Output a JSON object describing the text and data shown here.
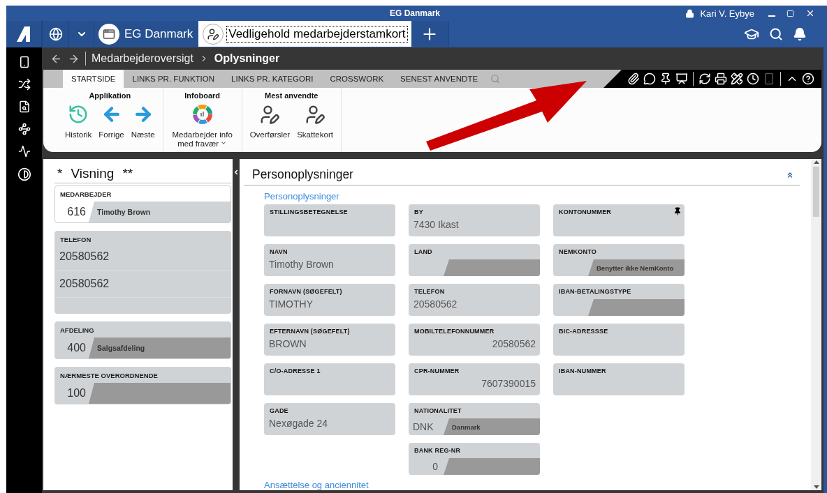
{
  "window": {
    "title": "EG Danmark",
    "user": "Kari V. Eybye"
  },
  "app_tabs": [
    {
      "label": "EG Danmark",
      "selected": false
    },
    {
      "label": "Vedligehold medarbejderstamkort",
      "selected": true
    }
  ],
  "breadcrumb": {
    "parent": "Medarbejderoversigt",
    "current": "Oplysninger"
  },
  "ribbon_tabs": [
    {
      "label": "STARTSIDE",
      "selected": true
    },
    {
      "label": "LINKS PR. FUNKTION",
      "selected": false
    },
    {
      "label": "LINKS PR. KATEGORI",
      "selected": false
    },
    {
      "label": "CROSSWORK",
      "selected": false
    },
    {
      "label": "SENEST ANVENDTE",
      "selected": false
    }
  ],
  "toolbar": [
    {
      "kind": "attach",
      "disabled": false
    },
    {
      "kind": "chat",
      "disabled": false
    },
    {
      "kind": "pin",
      "disabled": false
    },
    {
      "kind": "presentation",
      "disabled": false
    },
    {
      "kind": "separator"
    },
    {
      "kind": "refresh",
      "disabled": false
    },
    {
      "kind": "print",
      "disabled": false
    },
    {
      "kind": "tools",
      "disabled": false
    },
    {
      "kind": "clock",
      "disabled": false
    },
    {
      "kind": "device",
      "disabled": true
    },
    {
      "kind": "separator"
    },
    {
      "kind": "collapse",
      "disabled": false
    },
    {
      "kind": "help",
      "disabled": false
    }
  ],
  "ribbon_groups": [
    {
      "title": "Applikation",
      "items": [
        {
          "label": "Historik",
          "kind": "history",
          "dropdown": false
        },
        {
          "label": "Forrige",
          "kind": "back",
          "dropdown": false
        },
        {
          "label": "Næste",
          "kind": "forward",
          "dropdown": false
        }
      ]
    },
    {
      "title": "Infoboard",
      "items": [
        {
          "label": "Medarbejder info med fravær",
          "kind": "chart",
          "dropdown": true
        }
      ]
    },
    {
      "title": "Mest anvendte",
      "items": [
        {
          "label": "Overførsler",
          "kind": "user-edit",
          "dropdown": false
        },
        {
          "label": "Skattekort",
          "kind": "user-edit",
          "dropdown": false
        }
      ]
    }
  ],
  "left_panel": {
    "prefix": "*",
    "title": "Visning",
    "suffix": "**",
    "cards": [
      {
        "label": "MEDARBEJDER",
        "kind": "lookup",
        "selected": true,
        "code": "616",
        "description": "Timothy Brown"
      },
      {
        "label": "TELEFON",
        "kind": "list",
        "selected": false,
        "lines": [
          "20580562",
          "20580562"
        ]
      },
      {
        "label": "AFDELING",
        "kind": "lookup",
        "selected": false,
        "code": "400",
        "description": "Salgsafdeling"
      },
      {
        "label": "NÆRMESTE OVERORDNENDE",
        "kind": "lookup",
        "selected": false,
        "code": "100"
      }
    ]
  },
  "section": {
    "title": "Personoplysninger",
    "group_title": "Personoplysninger",
    "next_group": "Ansættelse og anciennitet",
    "columns": [
      [
        {
          "label": "STILLINGSBETEGNELSE",
          "kind": "text",
          "pinned": false
        },
        {
          "label": "NAVN",
          "kind": "text",
          "value": "Timothy Brown",
          "pinned": false
        },
        {
          "label": "FORNAVN (SØGEFELT)",
          "kind": "text",
          "value": "TIMOTHY",
          "pinned": false
        },
        {
          "label": "EFTERNAVN (SØGEFELT)",
          "kind": "text",
          "value": "BROWN",
          "pinned": false
        },
        {
          "label": "C/O-ADRESSE 1",
          "kind": "text",
          "pinned": false
        },
        {
          "label": "GADE",
          "kind": "text",
          "value": "Nexøgade 24",
          "pinned": false
        }
      ],
      [
        {
          "label": "BY",
          "kind": "text",
          "value": "7430 Ikast",
          "pinned": false
        },
        {
          "label": "LAND",
          "kind": "lookup",
          "pinned": false
        },
        {
          "label": "TELEFON",
          "kind": "text",
          "value": "20580562",
          "pinned": false
        },
        {
          "label": "MOBILTELEFONNUMMER",
          "kind": "number",
          "value": "20580562",
          "pinned": false
        },
        {
          "label": "CPR-NUMMER",
          "kind": "number",
          "value": "7607390015",
          "pinned": false
        },
        {
          "label": "NATIONALITET",
          "kind": "lookup",
          "code": "DNK",
          "description": "Danmark",
          "pinned": false
        },
        {
          "label": "BANK REG-NR",
          "kind": "lookup",
          "code": "0",
          "pinned": false
        }
      ],
      [
        {
          "label": "KONTONUMMER",
          "kind": "text",
          "pinned": true
        },
        {
          "label": "NEMKONTO",
          "kind": "lookup",
          "description": "Benytter ikke NemKonto",
          "pinned": false
        },
        {
          "label": "IBAN-BETALINGSTYPE",
          "kind": "lookup",
          "pinned": false
        },
        {
          "label": "BIC-ADRESSSE",
          "kind": "text",
          "pinned": false
        },
        {
          "label": "IBAN-NUMMER",
          "kind": "text",
          "pinned": false
        }
      ]
    ]
  }
}
